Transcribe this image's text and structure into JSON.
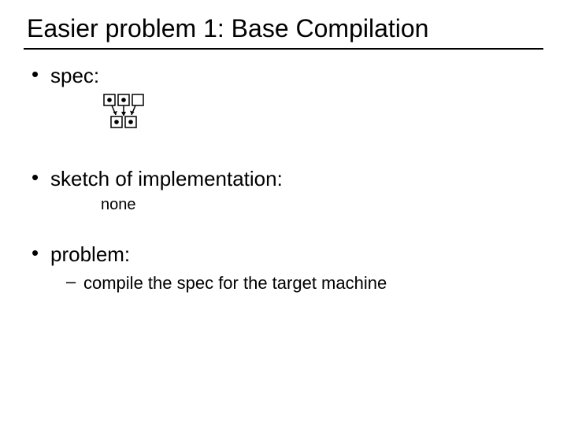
{
  "title": "Easier problem 1: Base Compilation",
  "bullets": {
    "spec": "spec:",
    "sketch": "sketch of implementation:",
    "sketch_sub": "none",
    "problem": "problem:",
    "problem_sub": "compile the spec for the target machine"
  }
}
